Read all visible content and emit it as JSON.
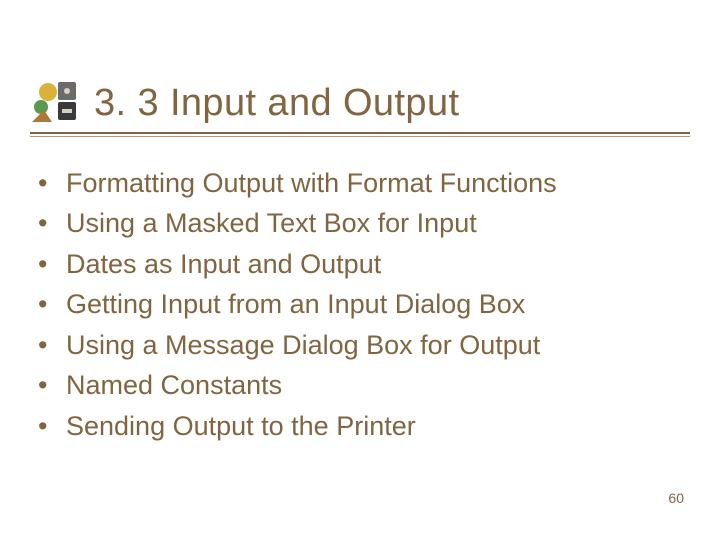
{
  "header": {
    "title": "3. 3 Input and Output"
  },
  "bullets": {
    "items": [
      {
        "text": "Formatting Output with Format Functions"
      },
      {
        "text": "Using a Masked Text Box for Input"
      },
      {
        "text": "Dates as Input and Output"
      },
      {
        "text": "Getting Input from an Input Dialog Box"
      },
      {
        "text": "Using a Message Dialog Box for Output"
      },
      {
        "text": "Named Constants"
      },
      {
        "text": "Sending Output to the Printer"
      }
    ]
  },
  "footer": {
    "page_number": "60"
  }
}
